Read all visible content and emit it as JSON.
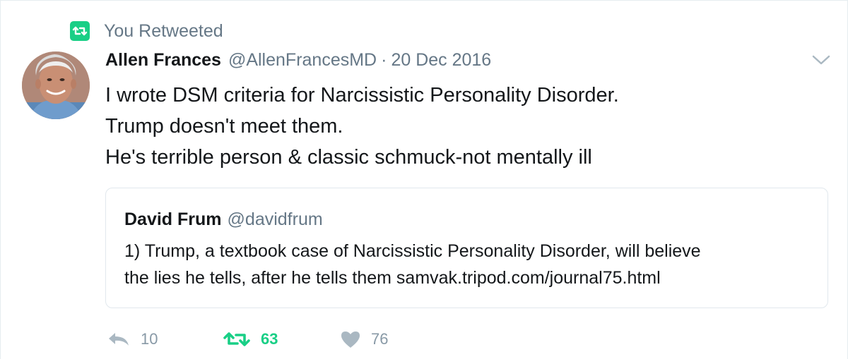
{
  "context": {
    "label": "You Retweeted",
    "icon": "retweet-icon",
    "color": "#19cf86"
  },
  "tweet": {
    "author_name": "Allen Frances",
    "author_handle": "@AllenFrancesMD",
    "separator": "·",
    "timestamp": "20 Dec 2016",
    "lines": [
      "I wrote DSM criteria for Narcissistic Personality Disorder.",
      "Trump doesn't meet them.",
      "He's terrible person & classic schmuck-not mentally ill"
    ],
    "menu_icon": "chevron-down-icon"
  },
  "quoted_tweet": {
    "author_name": "David Frum",
    "author_handle": "@davidfrum",
    "lines": [
      "1) Trump, a textbook case of Narcissistic Personality Disorder, will believe",
      "the lies he tells, after he tells them samvak.tripod.com/journal75.html"
    ]
  },
  "actions": {
    "reply": {
      "icon": "reply-icon",
      "count": "10"
    },
    "retweet": {
      "icon": "retweet-icon",
      "count": "63",
      "active_color": "#19cf86"
    },
    "like": {
      "icon": "heart-icon",
      "count": "76"
    }
  },
  "colors": {
    "text_primary": "#14171a",
    "text_secondary": "#657786",
    "action_gray": "#8899a6",
    "border": "#e1e8ed"
  }
}
